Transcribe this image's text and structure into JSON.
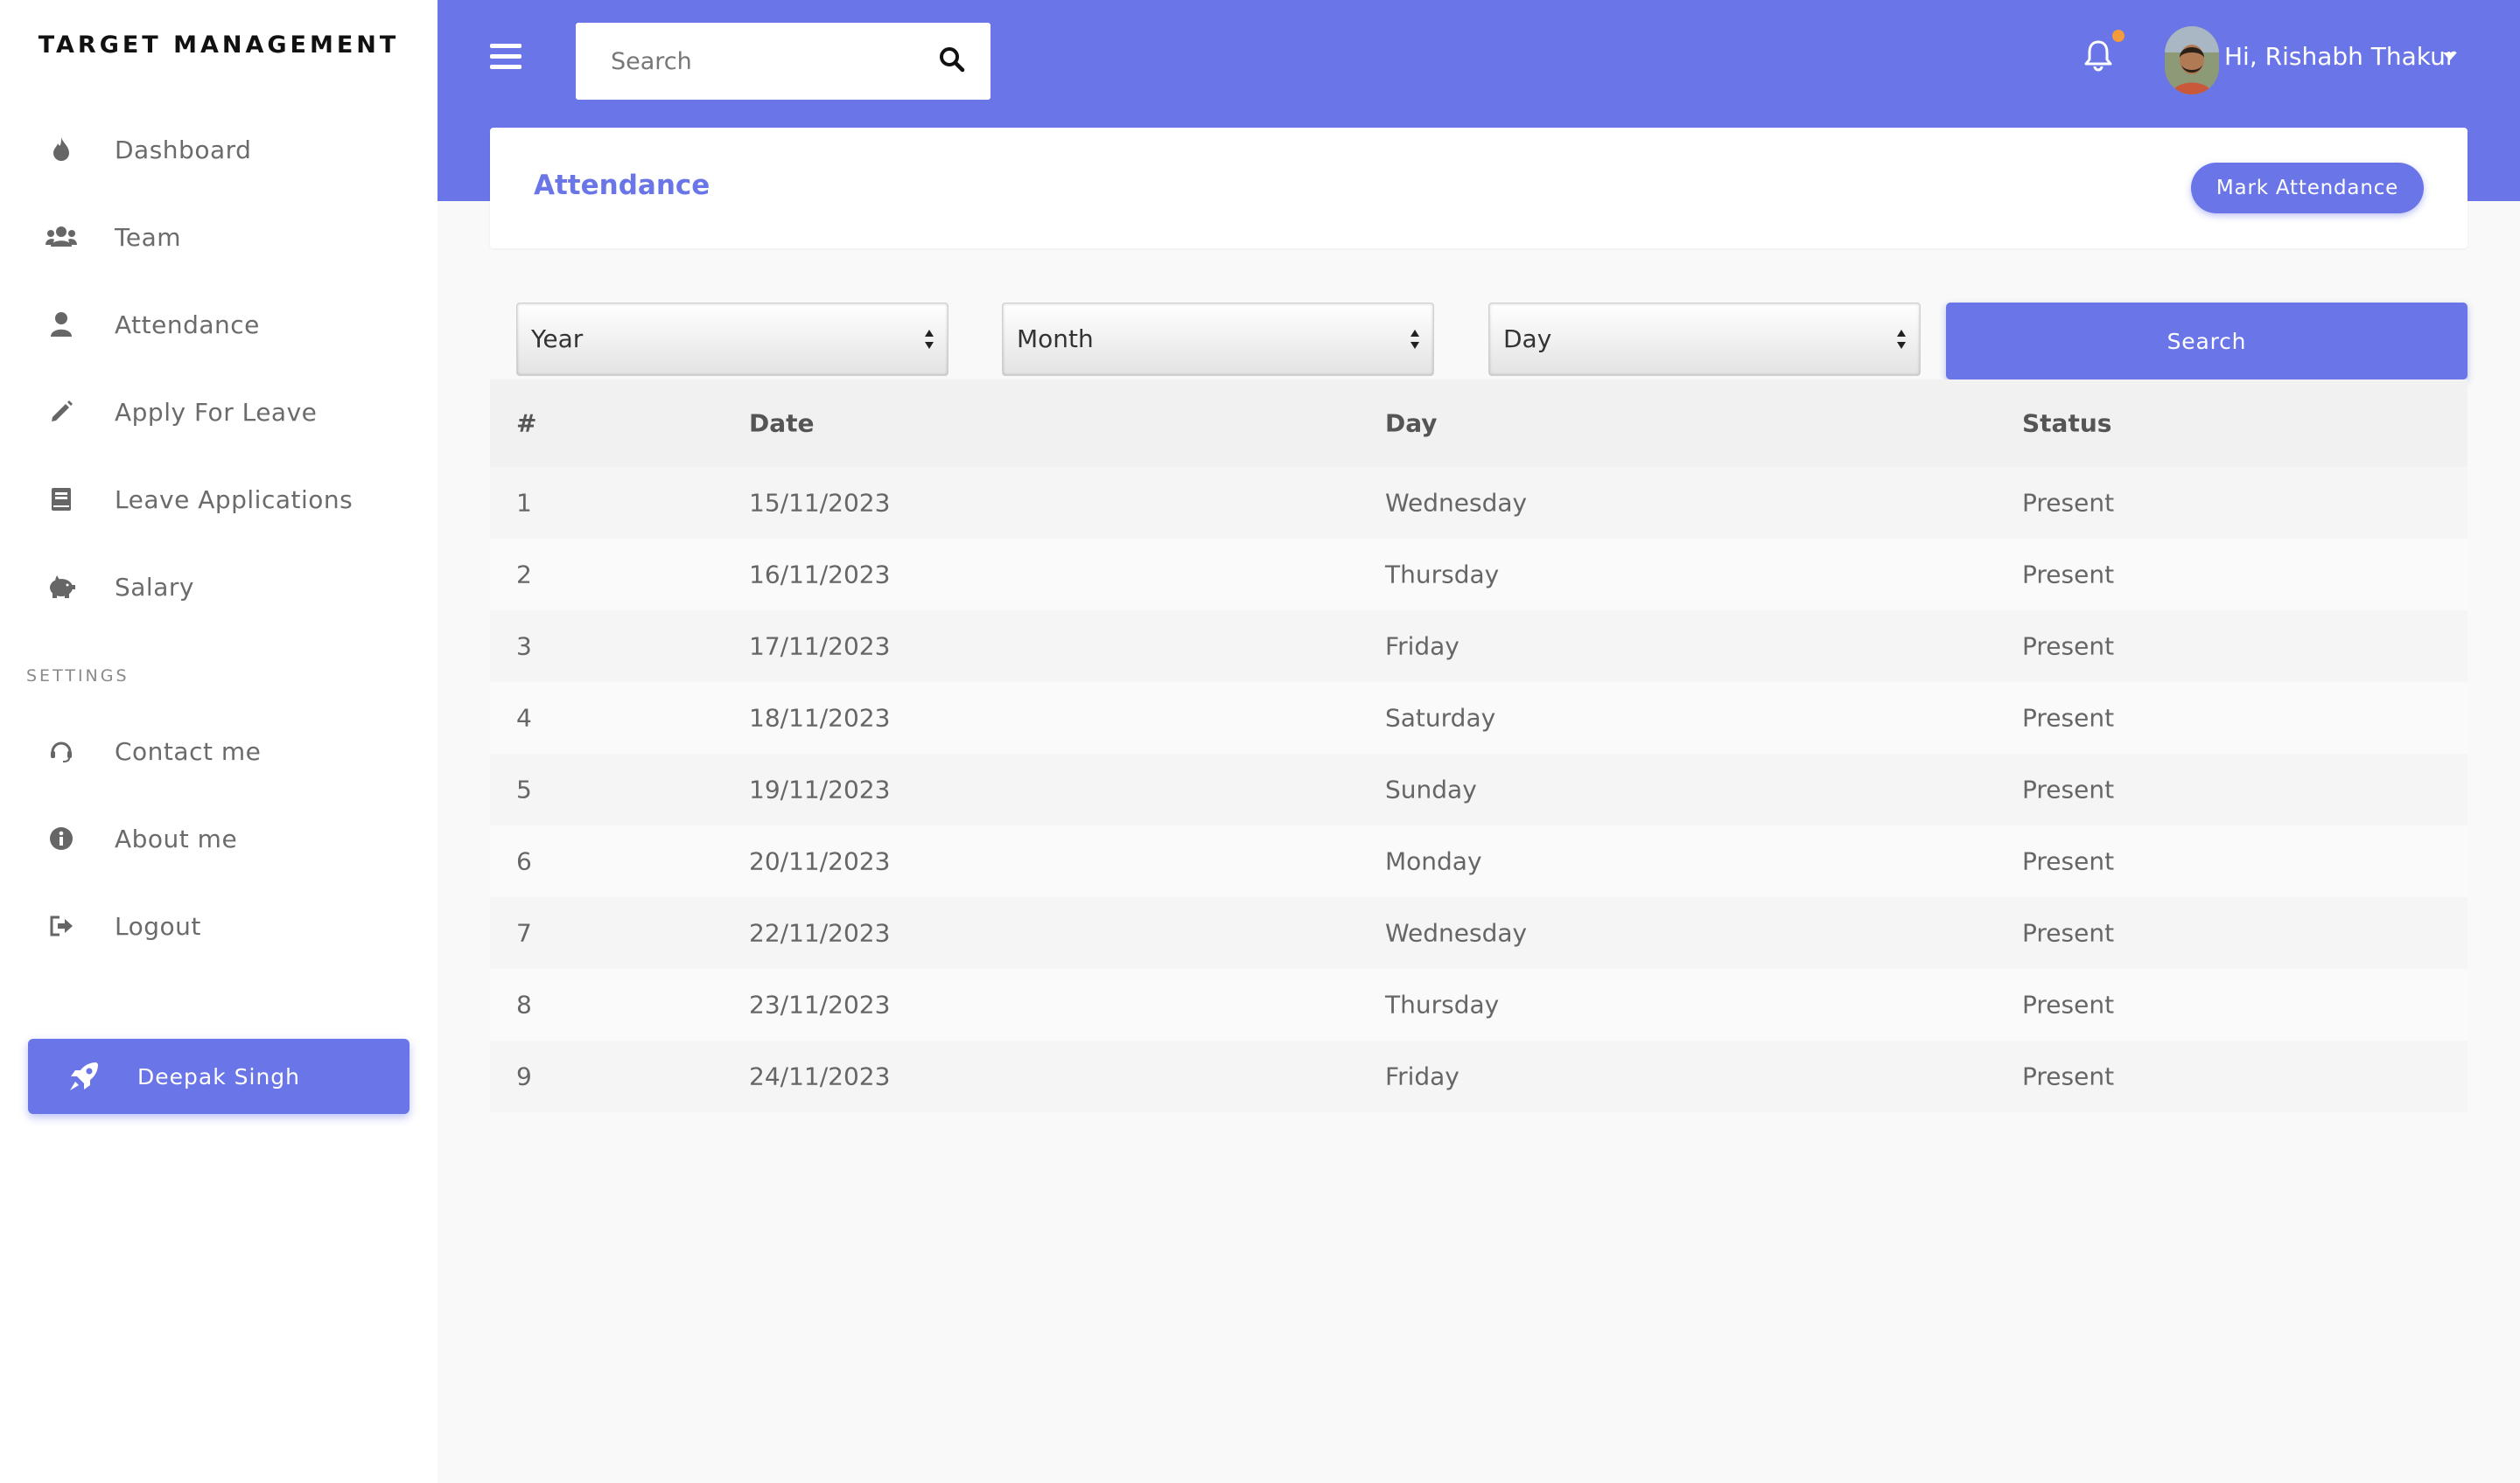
{
  "sidebar": {
    "brand": "TARGET MANAGEMENT",
    "items": [
      {
        "label": "Dashboard",
        "icon": "fire-icon"
      },
      {
        "label": "Team",
        "icon": "users-icon"
      },
      {
        "label": "Attendance",
        "icon": "user-icon"
      },
      {
        "label": "Apply For Leave",
        "icon": "pencil-icon"
      },
      {
        "label": "Leave Applications",
        "icon": "book-icon"
      },
      {
        "label": "Salary",
        "icon": "piggy-bank-icon"
      }
    ],
    "settings_title": "SETTINGS",
    "settings_items": [
      {
        "label": "Contact me",
        "icon": "headset-icon"
      },
      {
        "label": "About me",
        "icon": "info-icon"
      },
      {
        "label": "Logout",
        "icon": "sign-out-icon"
      }
    ],
    "user_card": {
      "name": "Deepak Singh",
      "icon": "rocket-icon"
    }
  },
  "header": {
    "search_placeholder": "Search",
    "greeting": "Hi, Rishabh Thakur",
    "accent_color": "#6a75e8",
    "notification_dot_color": "#f59b3b"
  },
  "card": {
    "title": "Attendance",
    "mark_button": "Mark Attendance"
  },
  "filters": {
    "year": "Year",
    "month": "Month",
    "day": "Day",
    "search_button": "Search"
  },
  "table": {
    "headers": [
      "#",
      "Date",
      "Day",
      "Status"
    ],
    "rows": [
      [
        "1",
        "15/11/2023",
        "Wednesday",
        "Present"
      ],
      [
        "2",
        "16/11/2023",
        "Thursday",
        "Present"
      ],
      [
        "3",
        "17/11/2023",
        "Friday",
        "Present"
      ],
      [
        "4",
        "18/11/2023",
        "Saturday",
        "Present"
      ],
      [
        "5",
        "19/11/2023",
        "Sunday",
        "Present"
      ],
      [
        "6",
        "20/11/2023",
        "Monday",
        "Present"
      ],
      [
        "7",
        "22/11/2023",
        "Wednesday",
        "Present"
      ],
      [
        "8",
        "23/11/2023",
        "Thursday",
        "Present"
      ],
      [
        "9",
        "24/11/2023",
        "Friday",
        "Present"
      ]
    ]
  }
}
